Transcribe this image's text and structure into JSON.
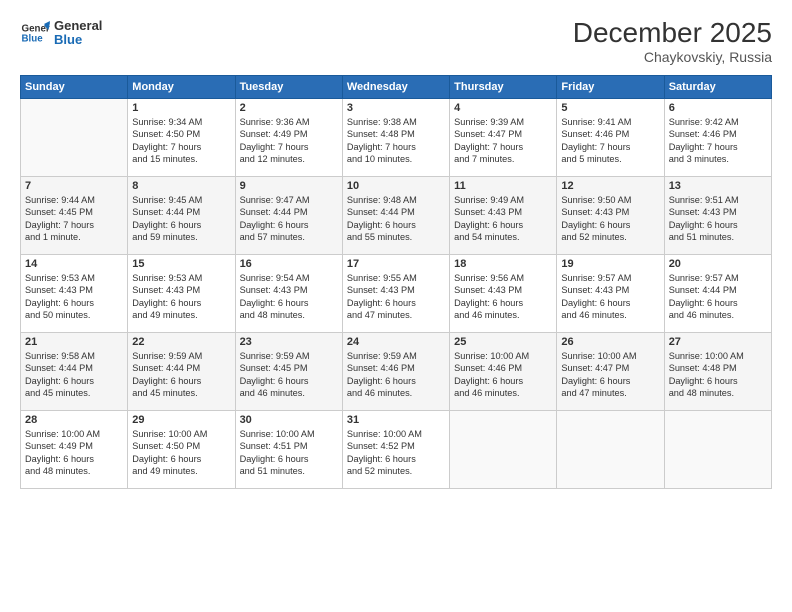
{
  "logo": {
    "line1": "General",
    "line2": "Blue"
  },
  "title": "December 2025",
  "subtitle": "Chaykovskiy, Russia",
  "header": {
    "days": [
      "Sunday",
      "Monday",
      "Tuesday",
      "Wednesday",
      "Thursday",
      "Friday",
      "Saturday"
    ]
  },
  "weeks": [
    [
      {
        "day": "",
        "info": ""
      },
      {
        "day": "1",
        "info": "Sunrise: 9:34 AM\nSunset: 4:50 PM\nDaylight: 7 hours\nand 15 minutes."
      },
      {
        "day": "2",
        "info": "Sunrise: 9:36 AM\nSunset: 4:49 PM\nDaylight: 7 hours\nand 12 minutes."
      },
      {
        "day": "3",
        "info": "Sunrise: 9:38 AM\nSunset: 4:48 PM\nDaylight: 7 hours\nand 10 minutes."
      },
      {
        "day": "4",
        "info": "Sunrise: 9:39 AM\nSunset: 4:47 PM\nDaylight: 7 hours\nand 7 minutes."
      },
      {
        "day": "5",
        "info": "Sunrise: 9:41 AM\nSunset: 4:46 PM\nDaylight: 7 hours\nand 5 minutes."
      },
      {
        "day": "6",
        "info": "Sunrise: 9:42 AM\nSunset: 4:46 PM\nDaylight: 7 hours\nand 3 minutes."
      }
    ],
    [
      {
        "day": "7",
        "info": "Sunrise: 9:44 AM\nSunset: 4:45 PM\nDaylight: 7 hours\nand 1 minute."
      },
      {
        "day": "8",
        "info": "Sunrise: 9:45 AM\nSunset: 4:44 PM\nDaylight: 6 hours\nand 59 minutes."
      },
      {
        "day": "9",
        "info": "Sunrise: 9:47 AM\nSunset: 4:44 PM\nDaylight: 6 hours\nand 57 minutes."
      },
      {
        "day": "10",
        "info": "Sunrise: 9:48 AM\nSunset: 4:44 PM\nDaylight: 6 hours\nand 55 minutes."
      },
      {
        "day": "11",
        "info": "Sunrise: 9:49 AM\nSunset: 4:43 PM\nDaylight: 6 hours\nand 54 minutes."
      },
      {
        "day": "12",
        "info": "Sunrise: 9:50 AM\nSunset: 4:43 PM\nDaylight: 6 hours\nand 52 minutes."
      },
      {
        "day": "13",
        "info": "Sunrise: 9:51 AM\nSunset: 4:43 PM\nDaylight: 6 hours\nand 51 minutes."
      }
    ],
    [
      {
        "day": "14",
        "info": "Sunrise: 9:53 AM\nSunset: 4:43 PM\nDaylight: 6 hours\nand 50 minutes."
      },
      {
        "day": "15",
        "info": "Sunrise: 9:53 AM\nSunset: 4:43 PM\nDaylight: 6 hours\nand 49 minutes."
      },
      {
        "day": "16",
        "info": "Sunrise: 9:54 AM\nSunset: 4:43 PM\nDaylight: 6 hours\nand 48 minutes."
      },
      {
        "day": "17",
        "info": "Sunrise: 9:55 AM\nSunset: 4:43 PM\nDaylight: 6 hours\nand 47 minutes."
      },
      {
        "day": "18",
        "info": "Sunrise: 9:56 AM\nSunset: 4:43 PM\nDaylight: 6 hours\nand 46 minutes."
      },
      {
        "day": "19",
        "info": "Sunrise: 9:57 AM\nSunset: 4:43 PM\nDaylight: 6 hours\nand 46 minutes."
      },
      {
        "day": "20",
        "info": "Sunrise: 9:57 AM\nSunset: 4:44 PM\nDaylight: 6 hours\nand 46 minutes."
      }
    ],
    [
      {
        "day": "21",
        "info": "Sunrise: 9:58 AM\nSunset: 4:44 PM\nDaylight: 6 hours\nand 45 minutes."
      },
      {
        "day": "22",
        "info": "Sunrise: 9:59 AM\nSunset: 4:44 PM\nDaylight: 6 hours\nand 45 minutes."
      },
      {
        "day": "23",
        "info": "Sunrise: 9:59 AM\nSunset: 4:45 PM\nDaylight: 6 hours\nand 46 minutes."
      },
      {
        "day": "24",
        "info": "Sunrise: 9:59 AM\nSunset: 4:46 PM\nDaylight: 6 hours\nand 46 minutes."
      },
      {
        "day": "25",
        "info": "Sunrise: 10:00 AM\nSunset: 4:46 PM\nDaylight: 6 hours\nand 46 minutes."
      },
      {
        "day": "26",
        "info": "Sunrise: 10:00 AM\nSunset: 4:47 PM\nDaylight: 6 hours\nand 47 minutes."
      },
      {
        "day": "27",
        "info": "Sunrise: 10:00 AM\nSunset: 4:48 PM\nDaylight: 6 hours\nand 48 minutes."
      }
    ],
    [
      {
        "day": "28",
        "info": "Sunrise: 10:00 AM\nSunset: 4:49 PM\nDaylight: 6 hours\nand 48 minutes."
      },
      {
        "day": "29",
        "info": "Sunrise: 10:00 AM\nSunset: 4:50 PM\nDaylight: 6 hours\nand 49 minutes."
      },
      {
        "day": "30",
        "info": "Sunrise: 10:00 AM\nSunset: 4:51 PM\nDaylight: 6 hours\nand 51 minutes."
      },
      {
        "day": "31",
        "info": "Sunrise: 10:00 AM\nSunset: 4:52 PM\nDaylight: 6 hours\nand 52 minutes."
      },
      {
        "day": "",
        "info": ""
      },
      {
        "day": "",
        "info": ""
      },
      {
        "day": "",
        "info": ""
      }
    ]
  ]
}
